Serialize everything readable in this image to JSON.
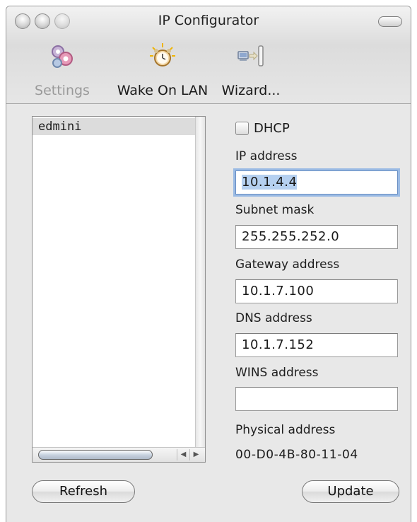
{
  "window": {
    "title": "IP Configurator"
  },
  "toolbar": {
    "items": [
      {
        "label": "Settings",
        "icon": "gears-icon",
        "enabled": false
      },
      {
        "label": "Wake On LAN",
        "icon": "alarm-clock-icon",
        "enabled": true
      },
      {
        "label": "Wizard...",
        "icon": "computer-wizard-icon",
        "enabled": true
      }
    ]
  },
  "device_list": {
    "items": [
      "edmini"
    ],
    "selected": "edmini"
  },
  "form": {
    "dhcp_label": "DHCP",
    "dhcp_checked": false,
    "ip_label": "IP address",
    "ip_value": "10.1.4.4",
    "subnet_label": "Subnet mask",
    "subnet_value": "255.255.252.0",
    "gateway_label": "Gateway address",
    "gateway_value": "10.1.7.100",
    "dns_label": "DNS address",
    "dns_value": "10.1.7.152",
    "wins_label": "WINS address",
    "wins_value": "",
    "physical_label": "Physical address",
    "physical_value": "00-D0-4B-80-11-04"
  },
  "buttons": {
    "refresh": "Refresh",
    "update": "Update"
  },
  "colors": {
    "window_bg": "#e8e8e8",
    "selection_row": "#dcdcdc",
    "focus_ring": "#9bbbe4",
    "text_selection": "#b5d0f0"
  }
}
